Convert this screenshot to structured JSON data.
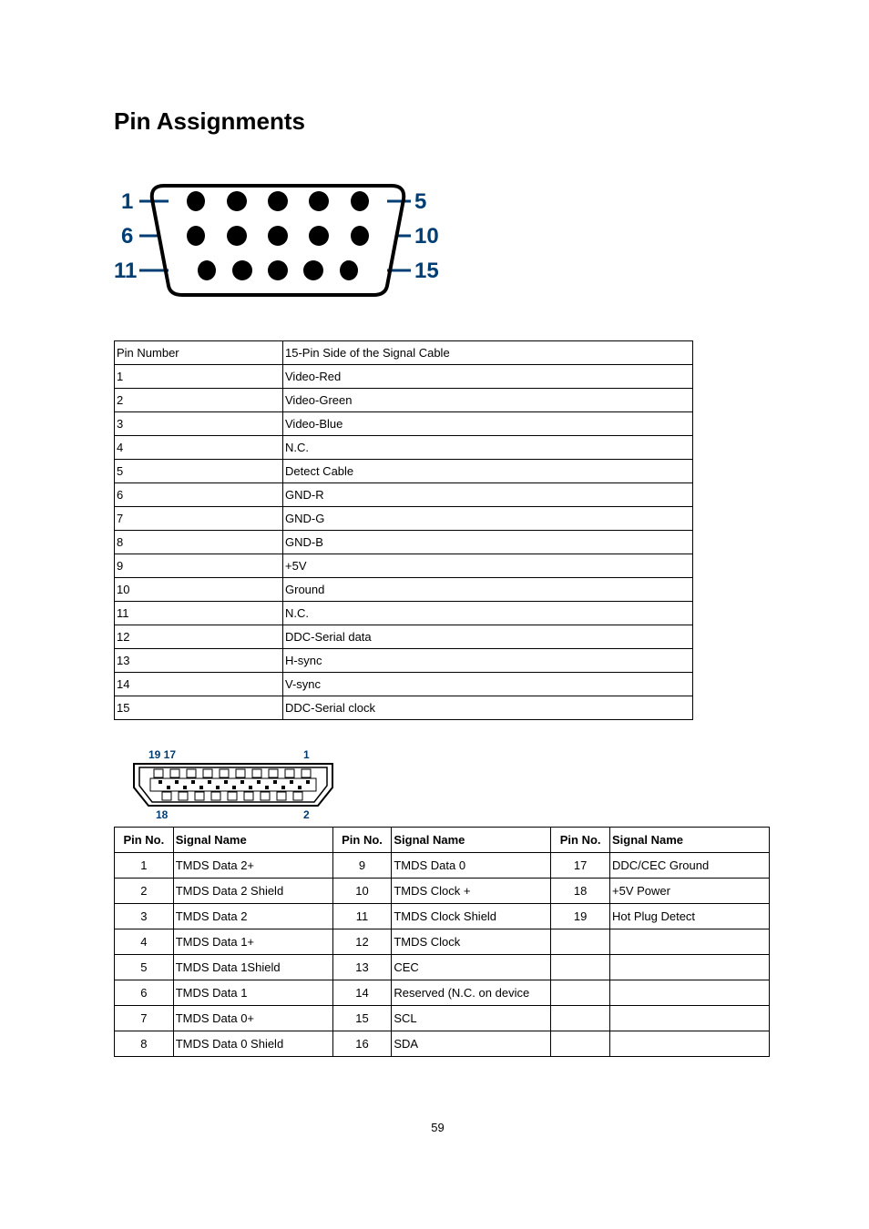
{
  "heading": "Pin Assignments",
  "vga_labels": {
    "l1": "1",
    "l6": "6",
    "l11": "11",
    "r5": "5",
    "r10": "10",
    "r15": "15"
  },
  "vga_table": {
    "head": {
      "c1": "Pin Number",
      "c2": "15-Pin Side of the Signal Cable"
    },
    "rows": [
      {
        "c1": "1",
        "c2": "Video-Red"
      },
      {
        "c1": "2",
        "c2": "Video-Green"
      },
      {
        "c1": "3",
        "c2": "Video-Blue"
      },
      {
        "c1": "4",
        "c2": "N.C."
      },
      {
        "c1": "5",
        "c2": "Detect Cable"
      },
      {
        "c1": "6",
        "c2": "GND-R"
      },
      {
        "c1": "7",
        "c2": "GND-G"
      },
      {
        "c1": "8",
        "c2": "GND-B"
      },
      {
        "c1": "9",
        "c2": "+5V"
      },
      {
        "c1": "10",
        "c2": "Ground"
      },
      {
        "c1": "11",
        "c2": "N.C."
      },
      {
        "c1": "12",
        "c2": "DDC-Serial data"
      },
      {
        "c1": "13",
        "c2": "H-sync"
      },
      {
        "c1": "14",
        "c2": "V-sync"
      },
      {
        "c1": "15",
        "c2": "DDC-Serial clock"
      }
    ]
  },
  "hdmi_labels": {
    "top_left": "19 17",
    "top_right": "1",
    "bot_left": "18",
    "bot_right": "2"
  },
  "hdmi_table": {
    "head": {
      "pin": "Pin No.",
      "sig": "Signal Name"
    },
    "rows": [
      {
        "p1": "1",
        "s1": "TMDS Data 2+",
        "p2": "9",
        "s2": "TMDS Data 0",
        "p3": "17",
        "s3": "DDC/CEC Ground"
      },
      {
        "p1": "2",
        "s1": "TMDS Data 2 Shield",
        "p2": "10",
        "s2": "TMDS Clock +",
        "p3": "18",
        "s3": "+5V Power"
      },
      {
        "p1": "3",
        "s1": "TMDS Data 2",
        "p2": "11",
        "s2": "TMDS Clock Shield",
        "p3": "19",
        "s3": "Hot Plug Detect"
      },
      {
        "p1": "4",
        "s1": "TMDS Data 1+",
        "p2": "12",
        "s2": "TMDS Clock",
        "p3": "",
        "s3": ""
      },
      {
        "p1": "5",
        "s1": "TMDS Data 1Shield",
        "p2": "13",
        "s2": "CEC",
        "p3": "",
        "s3": ""
      },
      {
        "p1": "6",
        "s1": "TMDS Data 1",
        "p2": "14",
        "s2": "Reserved (N.C. on device",
        "p3": "",
        "s3": ""
      },
      {
        "p1": "7",
        "s1": "TMDS Data 0+",
        "p2": "15",
        "s2": "SCL",
        "p3": "",
        "s3": ""
      },
      {
        "p1": "8",
        "s1": "TMDS Data 0 Shield",
        "p2": "16",
        "s2": "SDA",
        "p3": "",
        "s3": ""
      }
    ]
  },
  "page_number": "59"
}
